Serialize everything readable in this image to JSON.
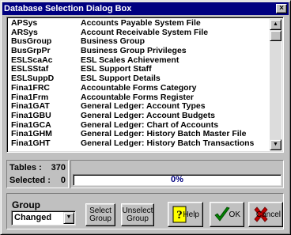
{
  "window": {
    "title": "Database Selection Dialog Box",
    "close_glyph": "×"
  },
  "list": {
    "items": [
      {
        "code": "APSys",
        "desc": "Accounts Payable System File"
      },
      {
        "code": "ARSys",
        "desc": "Account Receivable System File"
      },
      {
        "code": "BusGroup",
        "desc": "Business Group"
      },
      {
        "code": "BusGrpPr",
        "desc": "Business Group Privileges"
      },
      {
        "code": "ESLScaAc",
        "desc": "ESL Scales Achievement"
      },
      {
        "code": "ESLSStaf",
        "desc": "ESL Support Staff"
      },
      {
        "code": "ESLSuppD",
        "desc": "ESL Support Details"
      },
      {
        "code": "Fina1FRC",
        "desc": "Accountable Forms Category"
      },
      {
        "code": "Fina1Frm",
        "desc": "Accountable Forms Register"
      },
      {
        "code": "Fina1GAT",
        "desc": "General Ledger: Account Types"
      },
      {
        "code": "Fina1GBU",
        "desc": "General Ledger: Account Budgets"
      },
      {
        "code": "Fina1GCA",
        "desc": "General Ledger: Chart of Accounts"
      },
      {
        "code": "Fina1GHM",
        "desc": "General Ledger: History Batch Master File"
      },
      {
        "code": "Fina1GHT",
        "desc": "General Ledger: History Batch Transactions"
      }
    ]
  },
  "stats": {
    "tables_label": "Tables :",
    "tables_value": "370",
    "selected_label": "Selected :",
    "selected_value": "0"
  },
  "progress": {
    "text": "0%",
    "fraction": 0
  },
  "group": {
    "label": "Group",
    "value": "Changed"
  },
  "buttons": {
    "select_l1": "Select",
    "select_l2": "Group",
    "unselect_l1": "Unselect",
    "unselect_l2": "Group",
    "help": "Help",
    "ok": "OK",
    "cancel": "Cancel"
  },
  "colors": {
    "title_bar": "#000080",
    "face": "#c0c0c0",
    "ok_check": "#008000",
    "cancel_x": "#c00000"
  }
}
